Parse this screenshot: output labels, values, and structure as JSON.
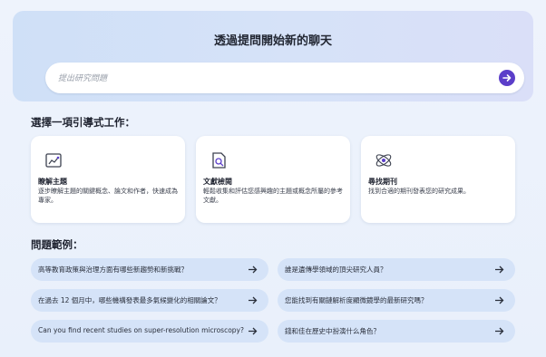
{
  "hero": {
    "title": "透過提問開始新的聊天",
    "search_placeholder": "提出研究問題",
    "send_icon": "arrow-right-circle-icon",
    "accent": "#5b3ec9"
  },
  "workflows": {
    "heading": "選擇一項引導式工作：",
    "cards": [
      {
        "icon": "topic-chart-icon",
        "title": "瞭解主題",
        "desc": "逐步瞭解主題的關鍵概念、論文和作者，快速成為專家。"
      },
      {
        "icon": "document-search-icon",
        "title": "文獻檢閱",
        "desc": "輕鬆收集和評估您感興趣的主題或概念所屬的參考文獻。"
      },
      {
        "icon": "atom-icon",
        "title": "尋找期刊",
        "desc": "找到合適的期刊發表您的研究成果。"
      }
    ]
  },
  "examples": {
    "heading": "問題範例：",
    "questions": [
      "高等教育政策與治理方面有哪些新趨勢和新挑戰？",
      "誰是遺傳學領域的頂尖研究人員？",
      "在過去 12 個月中，哪些機構發表最多氣候變化的相關論文？",
      "您能找到有關鏈解析度顯微鏡學的最新研究嗎？",
      "Can you find recent studies on super-resolution microscopy?",
      "錢和佳在歷史中扮演什么角色？"
    ]
  }
}
